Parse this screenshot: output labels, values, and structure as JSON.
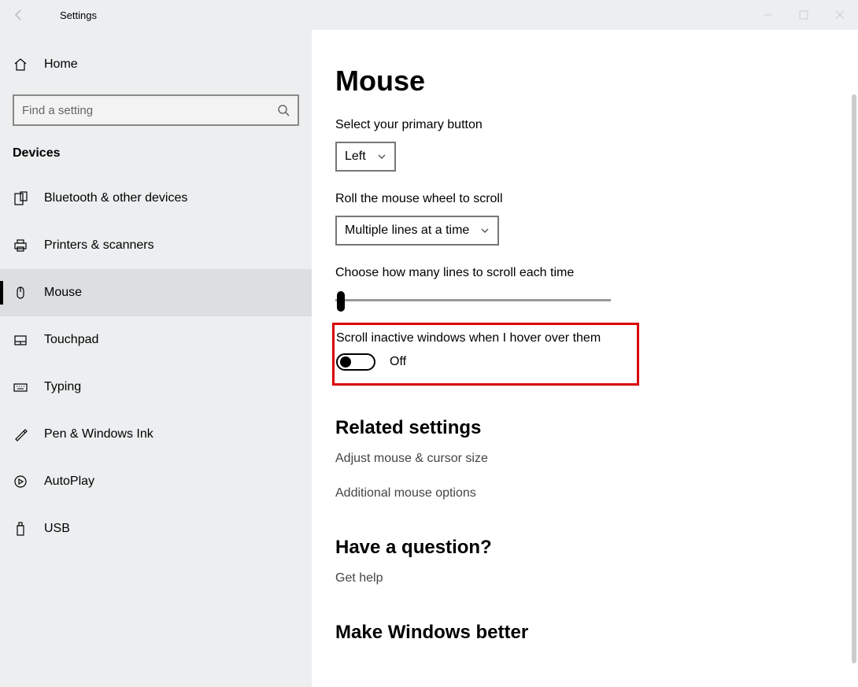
{
  "titlebar": {
    "title": "Settings"
  },
  "sidebar": {
    "home": "Home",
    "search_placeholder": "Find a setting",
    "section": "Devices",
    "items": [
      {
        "label": "Bluetooth & other devices"
      },
      {
        "label": "Printers & scanners"
      },
      {
        "label": "Mouse"
      },
      {
        "label": "Touchpad"
      },
      {
        "label": "Typing"
      },
      {
        "label": "Pen & Windows Ink"
      },
      {
        "label": "AutoPlay"
      },
      {
        "label": "USB"
      }
    ]
  },
  "main": {
    "heading": "Mouse",
    "primary_button_label": "Select your primary button",
    "primary_button_value": "Left",
    "wheel_label": "Roll the mouse wheel to scroll",
    "wheel_value": "Multiple lines at a time",
    "lines_label": "Choose how many lines to scroll each time",
    "inactive_label": "Scroll inactive windows when I hover over them",
    "inactive_state": "Off",
    "related_heading": "Related settings",
    "related_link1": "Adjust mouse & cursor size",
    "related_link2": "Additional mouse options",
    "question_heading": "Have a question?",
    "question_link": "Get help",
    "feedback_heading": "Make Windows better"
  }
}
